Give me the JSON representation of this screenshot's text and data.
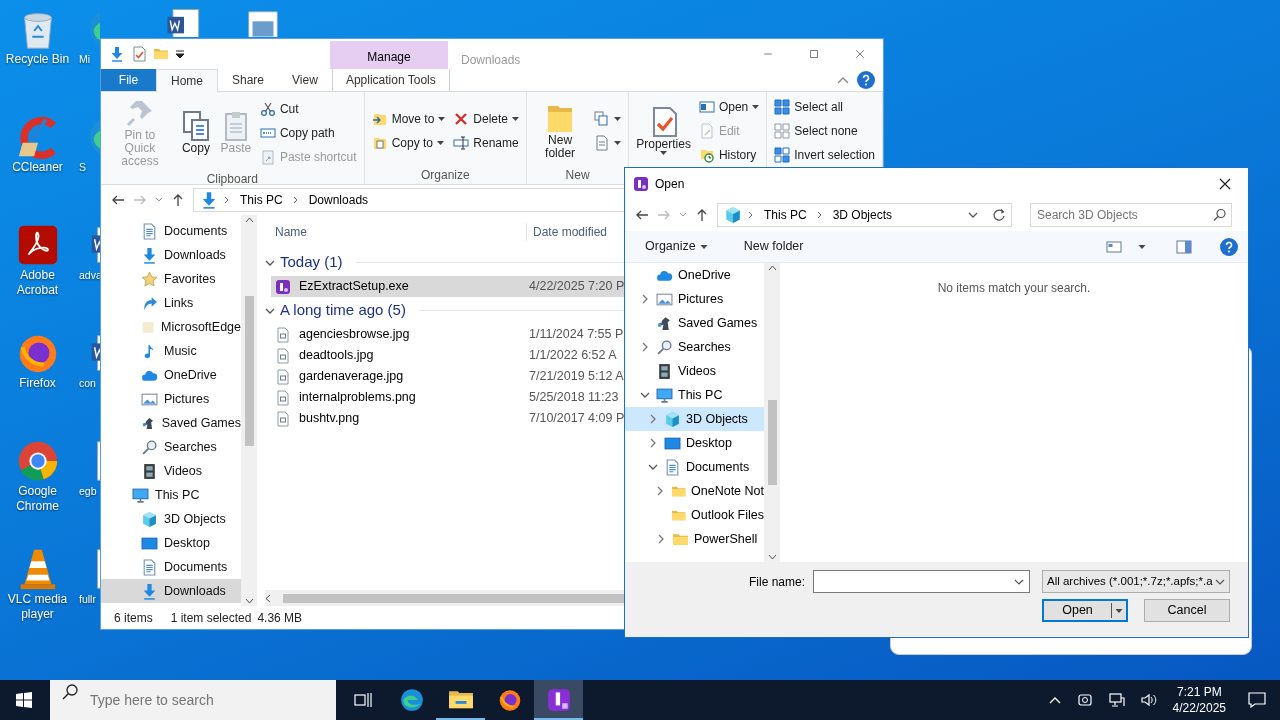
{
  "desktop": {
    "column_1": [
      {
        "label": "Recycle Bin",
        "kind": "recycle"
      },
      {
        "label": "CCleaner",
        "kind": "broom"
      },
      {
        "label": "Adobe Acrobat",
        "kind": "pdf"
      },
      {
        "label": "Firefox",
        "kind": "firefox"
      },
      {
        "label": "Google Chrome",
        "kind": "chrome"
      },
      {
        "label": "VLC media player",
        "kind": "cone"
      }
    ],
    "column_2": [
      {
        "label": "Mi",
        "kind": "edge"
      },
      {
        "label": "S",
        "kind": "edge"
      },
      {
        "label": "adva",
        "kind": "word"
      },
      {
        "label": "con",
        "kind": "word"
      },
      {
        "label": "egb",
        "kind": "file"
      },
      {
        "label": "fullr",
        "kind": "file"
      }
    ]
  },
  "explorer": {
    "title": "Downloads",
    "context_header": "Manage",
    "tabs": [
      {
        "label": "File",
        "kind": "menu",
        "selected": false
      },
      {
        "label": "Home",
        "kind": "tab",
        "selected": true
      },
      {
        "label": "Share",
        "kind": "tab",
        "selected": false
      },
      {
        "label": "View",
        "kind": "tab",
        "selected": false
      },
      {
        "label": "Application Tools",
        "kind": "context",
        "selected": false
      }
    ],
    "ribbon": [
      {
        "label": "Clipboard",
        "columns": [
          {
            "large": {
              "label": "Pin to Quick access",
              "kind": "pin",
              "disabled": true,
              "dropdown": false
            }
          },
          {
            "large": {
              "label": "Copy",
              "kind": "copy",
              "disabled": false,
              "dropdown": false
            }
          },
          {
            "large": {
              "label": "Paste",
              "kind": "paste",
              "disabled": true,
              "dropdown": false
            }
          },
          {
            "small": [
              {
                "label": "Cut",
                "kind": "cut",
                "disabled": false,
                "dropdown": false
              },
              {
                "label": "Copy path",
                "kind": "copy-path",
                "disabled": false,
                "dropdown": false
              },
              {
                "label": "Paste shortcut",
                "kind": "paste-shortcut",
                "disabled": true,
                "dropdown": false
              }
            ]
          }
        ]
      },
      {
        "label": "Organize",
        "columns": [
          {
            "small": [
              {
                "label": "Move to",
                "kind": "move",
                "disabled": false,
                "dropdown": true
              },
              {
                "label": "Copy to",
                "kind": "copy-to",
                "disabled": false,
                "dropdown": true
              }
            ]
          },
          {
            "small": [
              {
                "label": "Delete",
                "kind": "delete",
                "disabled": false,
                "dropdown": true
              },
              {
                "label": "Rename",
                "kind": "rename",
                "disabled": false,
                "dropdown": false
              }
            ]
          }
        ]
      },
      {
        "label": "New",
        "columns": [
          {
            "large": {
              "label": "New folder",
              "kind": "new-folder",
              "disabled": false,
              "dropdown": false
            }
          },
          {
            "small": [
              {
                "kind": "new-item",
                "disabled": false,
                "dropdown": true
              },
              {
                "kind": "easy-access",
                "disabled": false,
                "dropdown": true
              }
            ]
          }
        ]
      },
      {
        "columns": [
          {
            "large": {
              "label": "Properties",
              "kind": "properties",
              "disabled": false,
              "dropdown": true
            }
          },
          {
            "small": [
              {
                "label": "Open",
                "kind": "open",
                "disabled": false,
                "dropdown": true
              },
              {
                "label": "Edit",
                "kind": "edit",
                "disabled": true,
                "dropdown": false
              },
              {
                "label": "History",
                "kind": "history",
                "disabled": false,
                "dropdown": false
              }
            ]
          }
        ]
      },
      {
        "columns": [
          {
            "small": [
              {
                "label": "Select all",
                "kind": "select-all",
                "disabled": false,
                "dropdown": false
              },
              {
                "label": "Select none",
                "kind": "select-none",
                "disabled": false,
                "dropdown": false
              },
              {
                "label": "Invert selection",
                "kind": "invert",
                "disabled": false,
                "dropdown": false
              }
            ]
          }
        ]
      }
    ],
    "path": [
      "This PC",
      "Downloads"
    ],
    "nav_pane": [
      {
        "label": "Documents",
        "kind": "document",
        "selected": false
      },
      {
        "label": "Downloads",
        "kind": "downloads",
        "selected": false
      },
      {
        "label": "Favorites",
        "kind": "star",
        "selected": false
      },
      {
        "label": "Links",
        "kind": "link",
        "selected": false
      },
      {
        "label": "MicrosoftEdge",
        "kind": "pale-folder",
        "selected": false
      },
      {
        "label": "Music",
        "kind": "music",
        "selected": false
      },
      {
        "label": "OneDrive",
        "kind": "cloud",
        "selected": false
      },
      {
        "label": "Pictures",
        "kind": "pictures",
        "selected": false
      },
      {
        "label": "Saved Games",
        "kind": "games",
        "selected": false
      },
      {
        "label": "Searches",
        "kind": "search",
        "selected": false
      },
      {
        "label": "Videos",
        "kind": "video",
        "selected": false
      },
      {
        "label": "This PC",
        "kind": "pc",
        "selected": false,
        "children": [
          {
            "label": "3D Objects",
            "kind": "cube",
            "selected": false
          },
          {
            "label": "Desktop",
            "kind": "desktop",
            "selected": false
          },
          {
            "label": "Documents",
            "kind": "document",
            "selected": false
          },
          {
            "label": "Downloads",
            "kind": "downloads",
            "selected": true
          }
        ]
      }
    ],
    "columns": [
      "Name",
      "Date modified"
    ],
    "groups": [
      {
        "label": "Today (1)",
        "expanded": true,
        "files": [
          {
            "name": "EzExtractSetup.exe",
            "kind": "app",
            "date": "4/22/2025 7:20 P",
            "selected": true
          }
        ]
      },
      {
        "label": "A long time ago (5)",
        "expanded": true,
        "files": [
          {
            "name": "agenciesbrowse.jpg",
            "kind": "image-file",
            "date": "1/11/2024 7:55 P",
            "selected": false
          },
          {
            "name": "deadtools.jpg",
            "kind": "image-file",
            "date": "1/1/2022 6:52 A",
            "selected": false
          },
          {
            "name": "gardenaverage.jpg",
            "kind": "image-file",
            "date": "7/21/2019 5:12 A",
            "selected": false
          },
          {
            "name": "internalproblems.png",
            "kind": "image-file",
            "date": "5/25/2018 11:23",
            "selected": false
          },
          {
            "name": "bushtv.png",
            "kind": "image-file",
            "date": "7/10/2017 4:09 P",
            "selected": false
          }
        ]
      }
    ],
    "status_bar": {
      "items": "6 items",
      "selection": "1 item selected",
      "size": "4.36 MB"
    }
  },
  "open_dialog": {
    "title": "Open",
    "path": [
      "This PC",
      "3D Objects"
    ],
    "search": {
      "placeholder": "Search 3D Objects"
    },
    "organize": "Organize",
    "new_folder": "New folder",
    "tree": [
      {
        "label": "OneDrive",
        "kind": "cloud",
        "selected": false
      },
      {
        "label": "Pictures",
        "kind": "pictures",
        "selected": false,
        "expanded": false
      },
      {
        "label": "Saved Games",
        "kind": "games",
        "selected": false
      },
      {
        "label": "Searches",
        "kind": "search",
        "selected": false,
        "expanded": false
      },
      {
        "label": "Videos",
        "kind": "video",
        "selected": false
      },
      {
        "label": "This PC",
        "kind": "pc",
        "selected": false,
        "expanded": true,
        "children": [
          {
            "label": "3D Objects",
            "kind": "cube",
            "selected": true,
            "expanded": false
          },
          {
            "label": "Desktop",
            "kind": "desktop",
            "selected": false,
            "expanded": false
          },
          {
            "label": "Documents",
            "kind": "document",
            "selected": false,
            "expanded": true,
            "children": [
              {
                "label": "OneNote Not",
                "kind": "folder",
                "selected": false,
                "expanded": false
              },
              {
                "label": "Outlook Files",
                "kind": "folder",
                "selected": false
              },
              {
                "label": "PowerShell",
                "kind": "folder",
                "selected": false,
                "expanded": false
              }
            ]
          }
        ]
      }
    ],
    "empty_message": "No items match your search.",
    "file_name_label": "File name:",
    "filter": "All archives (*.001;*.7z;*.apfs;*.a",
    "buttons": [
      {
        "label": "Open",
        "kind": "split",
        "default": true
      },
      {
        "label": "Cancel",
        "kind": "plain",
        "default": false
      }
    ]
  },
  "taskbar": {
    "search": {
      "placeholder": "Type here to search"
    },
    "apps": [
      {
        "kind": "edge",
        "running": false,
        "selected": false
      },
      {
        "kind": "explorer",
        "running": true,
        "selected": false
      },
      {
        "kind": "firefox",
        "running": false,
        "selected": false
      },
      {
        "kind": "archiver",
        "running": true,
        "selected": true
      }
    ],
    "time": "7:21 PM",
    "date": "4/22/2025"
  }
}
